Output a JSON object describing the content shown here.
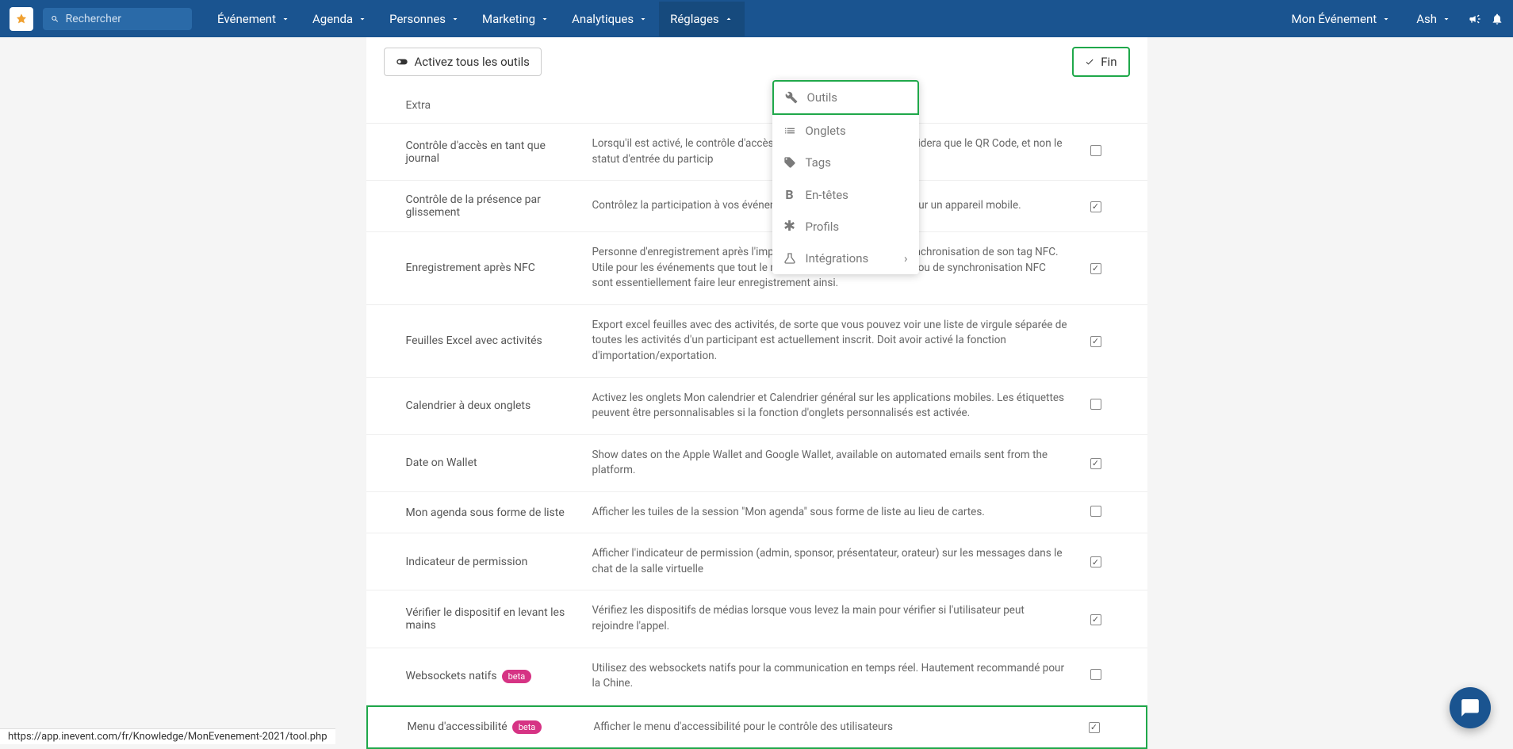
{
  "topbar": {
    "search_placeholder": "Rechercher",
    "nav_items": [
      {
        "label": "Événement"
      },
      {
        "label": "Agenda"
      },
      {
        "label": "Personnes"
      },
      {
        "label": "Marketing"
      },
      {
        "label": "Analytiques"
      },
      {
        "label": "Réglages"
      }
    ],
    "event_label": "Mon Événement",
    "user_label": "Ash"
  },
  "toolbar": {
    "activate_label": "Activez tous les outils",
    "done_label": "Fin"
  },
  "dropdown": {
    "items": [
      {
        "label": "Outils"
      },
      {
        "label": "Onglets"
      },
      {
        "label": "Tags"
      },
      {
        "label": "En-têtes"
      },
      {
        "label": "Profils"
      },
      {
        "label": "Intégrations"
      }
    ]
  },
  "section": {
    "header": "Extra"
  },
  "rows": [
    {
      "name": "Contrôle d'accès en tant que journal",
      "desc": "Lorsqu'il est activé, le contrôle d'accès fait __________ nifie qu'il ne validera que le QR Code, et non le statut d'entrée du particip",
      "checked": false
    },
    {
      "name": "Contrôle de la présence par glissement",
      "desc": "Contrôlez la participation à vos événeme __________ on de balayage sur un appareil mobile.",
      "checked": true
    },
    {
      "name": "Enregistrement après NFC",
      "desc": "Personne d'enregistrement après l'impression de leur badge ou la synchronisation de son tag NFC. Utile pour les événements que tout le monde l'impression de badges ou de synchronisation NFC sont essentiellement faire leur enregistrement ainsi.",
      "checked": true
    },
    {
      "name": "Feuilles Excel avec activités",
      "desc": "Export excel feuilles avec des activités, de sorte que vous pouvez voir une liste de virgule séparée de toutes les activités d'un participant est actuellement inscrit. Doit avoir activé la fonction d'importation/exportation.",
      "checked": true
    },
    {
      "name": "Calendrier à deux onglets",
      "desc": "Activez les onglets Mon calendrier et Calendrier général sur les applications mobiles. Les étiquettes peuvent être personnalisables si la fonction d'onglets personnalisés est activée.",
      "checked": false
    },
    {
      "name": "Date on Wallet",
      "desc": "Show dates on the Apple Wallet and Google Wallet, available on automated emails sent from the platform.",
      "checked": true
    },
    {
      "name": "Mon agenda sous forme de liste",
      "desc": "Afficher les tuiles de la session \"Mon agenda\" sous forme de liste au lieu de cartes.",
      "checked": false
    },
    {
      "name": "Indicateur de permission",
      "desc": "Afficher l'indicateur de permission (admin, sponsor, présentateur, orateur) sur les messages dans le chat de la salle virtuelle",
      "checked": true
    },
    {
      "name": "Vérifier le dispositif en levant les mains",
      "desc": "Vérifiez les dispositifs de médias lorsque vous levez la main pour vérifier si l'utilisateur peut rejoindre l'appel.",
      "checked": true
    },
    {
      "name": "Websockets natifs",
      "desc": "Utilisez des websockets natifs pour la communication en temps réel. Hautement recommandé pour la Chine.",
      "checked": false,
      "beta": "beta"
    },
    {
      "name": "Menu d'accessibilité",
      "desc": "Afficher le menu d'accessibilité pour le contrôle des utilisateurs",
      "checked": true,
      "beta": "beta",
      "highlight": true
    }
  ],
  "status_url": "https://app.inevent.com/fr/Knowledge/MonEvenement-2021/tool.php"
}
